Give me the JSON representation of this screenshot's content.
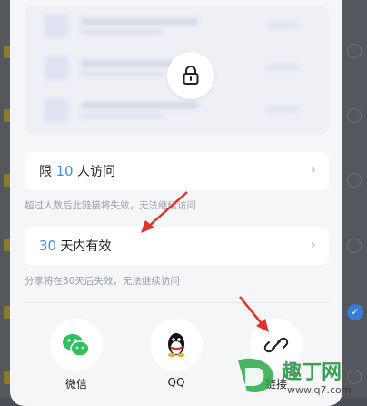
{
  "limit_card": {
    "prefix": "限",
    "count": "10",
    "suffix": "人访问"
  },
  "limit_hint": "超过人数后此链接将失效，无法继续访问",
  "validity_card": {
    "count": "30",
    "suffix": "天内有效"
  },
  "validity_hint": "分享将在30天后失效，无法继续访问",
  "share_targets": [
    {
      "label": "微信",
      "icon": "wechat-icon"
    },
    {
      "label": "QQ",
      "icon": "qq-icon"
    },
    {
      "label": "链接",
      "icon": "link-icon"
    }
  ],
  "watermark": {
    "text": "趣丁网",
    "url": "www.q7.com"
  },
  "colors": {
    "accent": "#3d8ee8",
    "wechat": "#2fc160",
    "arrow": "#e0312b"
  }
}
